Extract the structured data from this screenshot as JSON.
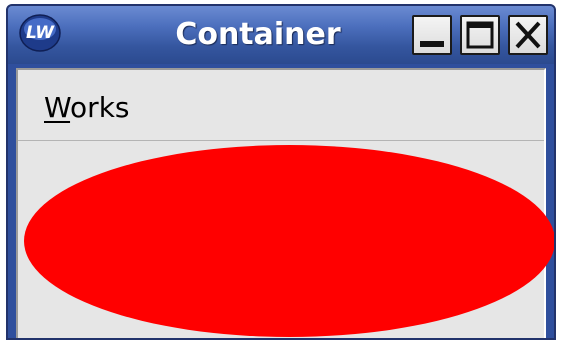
{
  "window": {
    "title": "Container",
    "app_icon_text": "LW"
  },
  "titlebar_buttons": {
    "minimize": "minimize",
    "maximize": "maximize",
    "close": "close"
  },
  "menu": {
    "items": [
      {
        "label_first": "W",
        "label_rest": "orks"
      }
    ]
  },
  "canvas": {
    "shape": "ellipse",
    "fill_color": "#ff0000"
  },
  "colors": {
    "titlebar": "#4c6fbd",
    "client_background": "#e6e6e6"
  }
}
